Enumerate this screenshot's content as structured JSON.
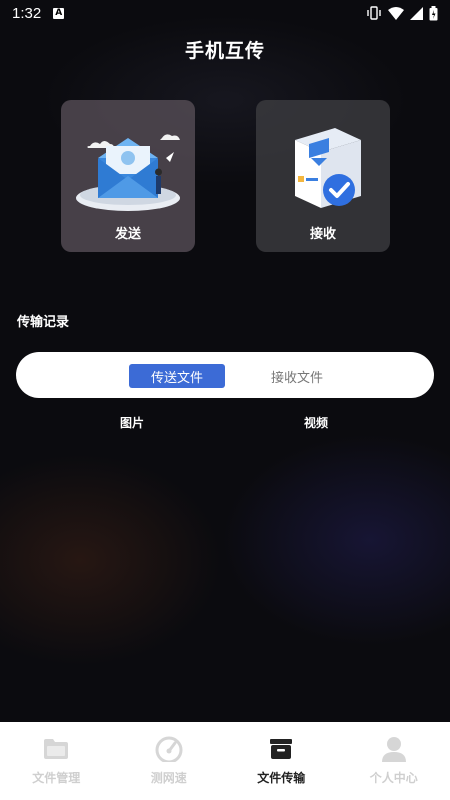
{
  "status_bar": {
    "time": "1:32",
    "notification_badge": "A",
    "icons": [
      "vibrate-icon",
      "wifi-icon",
      "signal-icon",
      "battery-icon"
    ]
  },
  "header": {
    "title": "手机互传"
  },
  "actions": {
    "send_label": "发送",
    "receive_label": "接收"
  },
  "records": {
    "title": "传输记录",
    "segments": {
      "active": "传送文件",
      "inactive": "接收文件"
    },
    "sub_tabs": {
      "images": "图片",
      "videos": "视频"
    }
  },
  "tabbar": {
    "items": [
      {
        "label": "文件管理",
        "icon": "folder-icon",
        "active": false
      },
      {
        "label": "测网速",
        "icon": "speedometer-icon",
        "active": false
      },
      {
        "label": "文件传输",
        "icon": "transfer-box-icon",
        "active": true
      },
      {
        "label": "个人中心",
        "icon": "person-icon",
        "active": false
      }
    ]
  },
  "colors": {
    "accent": "#3c6bd6",
    "background": "#0b0b0f",
    "tab_active": "#222222",
    "tab_inactive": "#cfcfcf"
  }
}
